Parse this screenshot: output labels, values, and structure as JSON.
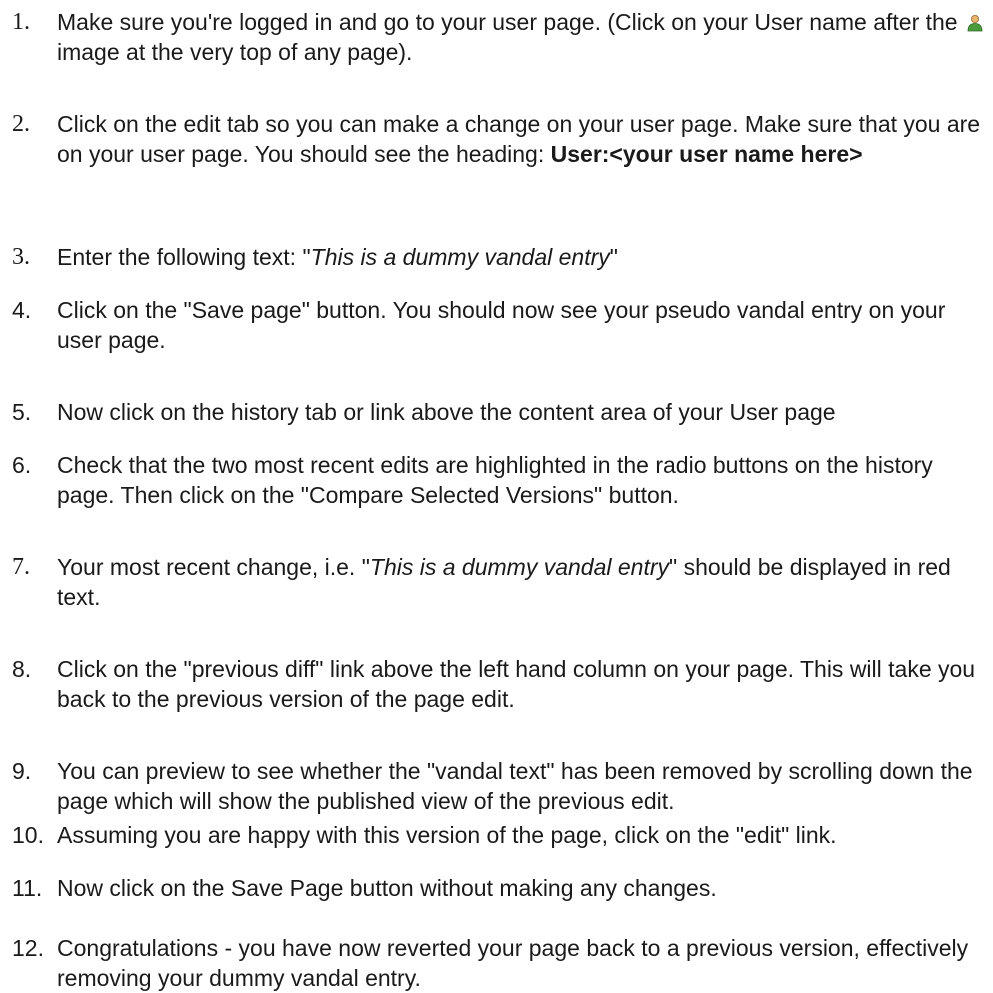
{
  "steps": [
    {
      "number": "1.",
      "parts": [
        "Make sure you're logged in and go to your user page. (Click on your User name after the ",
        " image at the very top of any page)."
      ],
      "icon": "user-icon"
    },
    {
      "number": "2.",
      "text_before": "Click on the edit tab so you can make a change on your user page. Make sure that you are on your user page. You should see the heading: ",
      "bold": "User:<your user name here>"
    },
    {
      "number": "3.",
      "text_before": "Enter the following text: \"",
      "italic": "This is a dummy vandal entry",
      "text_after": "\""
    },
    {
      "number": "4.",
      "text": "Click on the \"Save page\" button. You should now see your pseudo vandal entry on your user page."
    },
    {
      "number": "5.",
      "text": "Now click on the history tab or link above the content area of your User page"
    },
    {
      "number": "6.",
      "text": "Check that the two most recent edits are highlighted in the radio buttons on the history page. Then click on the \"Compare Selected Versions\" button."
    },
    {
      "number": "7.",
      "text_before": "Your most recent change, i.e. \"",
      "italic": "This is a dummy vandal entry",
      "text_after": "\" should be displayed in red text."
    },
    {
      "number": "8.",
      "text": "Click on the \"previous diff\" link above the left hand column on your page. This will take you back to the previous version of the page edit."
    },
    {
      "number": "9.",
      "text": "You can preview to see whether the \"vandal text\" has been removed by scrolling down the page which will show the published view of the previous edit."
    },
    {
      "number": "10.",
      "text": "Assuming you are happy with this version of the page, click on the \"edit\" link."
    },
    {
      "number": "11.",
      "text": "Now click on the Save Page button without making any changes."
    },
    {
      "number": "12.",
      "text": "Congratulations - you have now reverted your page back to a previous version, effectively removing your dummy vandal entry."
    }
  ]
}
